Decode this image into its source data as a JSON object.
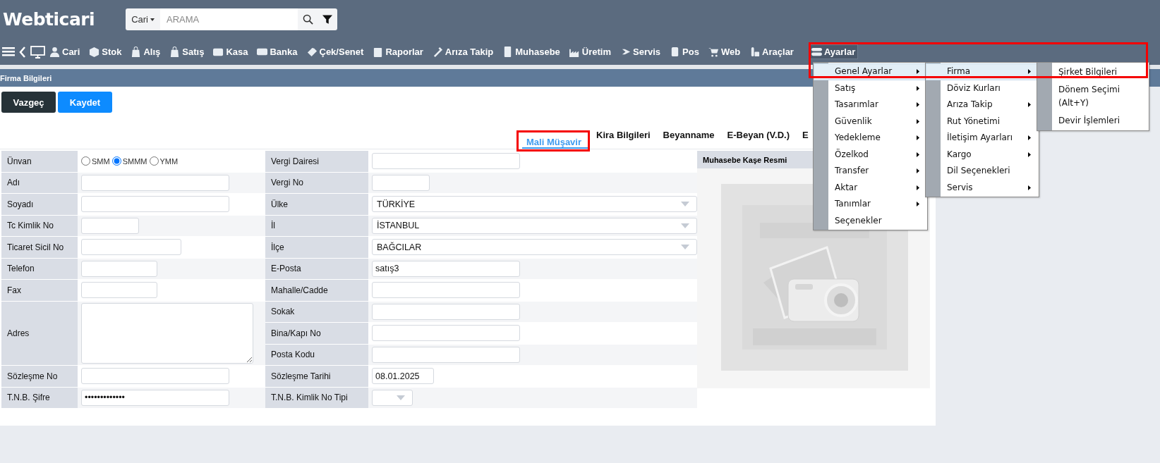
{
  "header": {
    "logo": "Webticari",
    "search": {
      "scope": "Cari",
      "placeholder": "ARAMA"
    }
  },
  "nav": [
    {
      "label": "Cari",
      "open": false
    },
    {
      "label": "Stok",
      "open": false
    },
    {
      "label": "Alış",
      "open": false
    },
    {
      "label": "Satış",
      "open": false
    },
    {
      "label": "Kasa",
      "open": false
    },
    {
      "label": "Banka",
      "open": false
    },
    {
      "label": "Çek/Senet",
      "open": false
    },
    {
      "label": "Raporlar",
      "open": false
    },
    {
      "label": "Arıza Takip",
      "open": false
    },
    {
      "label": "Muhasebe",
      "open": false
    },
    {
      "label": "Üretim",
      "open": false
    },
    {
      "label": "Servis",
      "open": false
    },
    {
      "label": "Pos",
      "open": false
    },
    {
      "label": "Web",
      "open": false
    },
    {
      "label": "Araçlar",
      "open": false
    },
    {
      "label": "Ayarlar",
      "open": true
    }
  ],
  "page_title": "Firma Bilgileri",
  "buttons": [
    {
      "label": "Vazgeç",
      "kind": "secondary"
    },
    {
      "label": "Kaydet",
      "kind": "primary"
    }
  ],
  "tabs": [
    {
      "label": "Mali Müşavir",
      "selected": true,
      "highlighted": true
    },
    {
      "label": "Kira Bilgileri",
      "selected": false,
      "highlighted": false
    },
    {
      "label": "Beyanname",
      "selected": false,
      "highlighted": false
    },
    {
      "label": "E-Beyan (V.D.)",
      "selected": false,
      "highlighted": false
    },
    {
      "label": "E",
      "selected": false,
      "highlighted": false
    }
  ],
  "form": {
    "left": [
      {
        "label": "Ünvan",
        "kind": "radio",
        "options": [
          {
            "label": "SMM",
            "selected": false
          },
          {
            "label": "SMMM",
            "selected": true
          },
          {
            "label": "YMM",
            "selected": false
          }
        ]
      },
      {
        "label": "Adı",
        "kind": "text"
      },
      {
        "label": "Soyadı",
        "kind": "text"
      },
      {
        "label": "Tc Kimlik No",
        "kind": "text"
      },
      {
        "label": "Ticaret Sicil No",
        "kind": "text"
      },
      {
        "label": "Telefon",
        "kind": "text"
      },
      {
        "label": "Fax",
        "kind": "text"
      },
      {
        "label": "Adres",
        "kind": "textarea"
      },
      {
        "label": "Sözleşme No",
        "kind": "text"
      },
      {
        "label": "T.N.B. Şifre",
        "kind": "password",
        "value": "•••••••••••••"
      }
    ],
    "right": [
      {
        "label": "Vergi Dairesi",
        "kind": "text"
      },
      {
        "label": "Vergi No",
        "kind": "text"
      },
      {
        "label": "Ülke",
        "kind": "select",
        "value": "TÜRKİYE"
      },
      {
        "label": "İl",
        "kind": "select",
        "value": "İSTANBUL"
      },
      {
        "label": "İlçe",
        "kind": "select",
        "value": "BAĞCILAR"
      },
      {
        "label": "E-Posta",
        "kind": "text",
        "value": "satış3"
      },
      {
        "label": "Mahalle/Cadde",
        "kind": "text"
      },
      {
        "label": "Sokak",
        "kind": "text"
      },
      {
        "label": "Bina/Kapı No",
        "kind": "text"
      },
      {
        "label": "Posta Kodu",
        "kind": "text"
      },
      {
        "label": "Sözleşme Tarihi",
        "kind": "text",
        "value": "08.01.2025"
      },
      {
        "label": "T.N.B. Kimlik No Tipi",
        "kind": "select"
      }
    ]
  },
  "image_panel": {
    "title": "Muhasebe Kaşe Resmi"
  },
  "menu": {
    "highlighted": true,
    "levels": [
      [
        {
          "label": "Genel Ayarlar",
          "submenu": true,
          "selected": true
        },
        {
          "label": "Satış",
          "submenu": true,
          "selected": false
        },
        {
          "label": "Tasarımlar",
          "submenu": true,
          "selected": false
        },
        {
          "label": "Güvenlik",
          "submenu": true,
          "selected": false
        },
        {
          "label": "Yedekleme",
          "submenu": true,
          "selected": false
        },
        {
          "label": "Özelkod",
          "submenu": true,
          "selected": false
        },
        {
          "label": "Transfer",
          "submenu": true,
          "selected": false
        },
        {
          "label": "Aktar",
          "submenu": true,
          "selected": false
        },
        {
          "label": "Tanımlar",
          "submenu": true,
          "selected": false
        },
        {
          "label": "Seçenekler",
          "submenu": false,
          "selected": false
        }
      ],
      [
        {
          "label": "Firma",
          "submenu": true,
          "selected": true
        },
        {
          "label": "Döviz Kurları",
          "submenu": false,
          "selected": false
        },
        {
          "label": "Arıza Takip",
          "submenu": true,
          "selected": false
        },
        {
          "label": "Rut Yönetimi",
          "submenu": false,
          "selected": false
        },
        {
          "label": "İletişim Ayarları",
          "submenu": true,
          "selected": false
        },
        {
          "label": "Kargo",
          "submenu": true,
          "selected": false
        },
        {
          "label": "Dil Seçenekleri",
          "submenu": false,
          "selected": false
        },
        {
          "label": "Servis",
          "submenu": true,
          "selected": false
        }
      ],
      [
        {
          "label": "Şirket Bilgileri",
          "submenu": false,
          "selected": false
        },
        {
          "label": "Dönem Seçimi (Alt+Y)",
          "submenu": false,
          "selected": false
        },
        {
          "label": "Devir İşlemleri",
          "submenu": false,
          "selected": false
        }
      ]
    ]
  }
}
